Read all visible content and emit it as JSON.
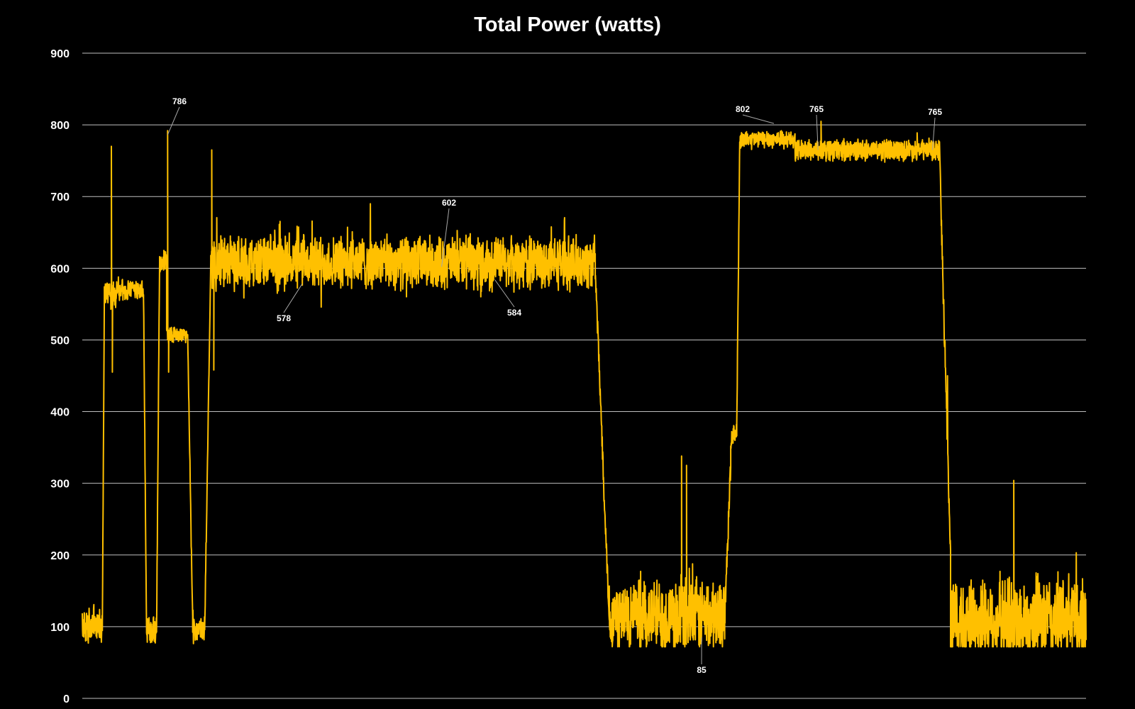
{
  "chart_data": {
    "type": "line",
    "title": "Total Power (watts)",
    "xlabel": "",
    "ylabel": "",
    "ylim": [
      0,
      900
    ],
    "yticks": [
      0,
      100,
      200,
      300,
      400,
      500,
      600,
      700,
      800,
      900
    ],
    "ytick_labels": [
      "0",
      "100",
      "200",
      "300",
      "400",
      "500",
      "600",
      "700",
      "800",
      "900"
    ],
    "grid": true,
    "legend": "none",
    "colors": {
      "line": "#FFC000",
      "background": "#000000",
      "grid": "#BFBFBF",
      "text": "#FFFFFF"
    },
    "series": [
      {
        "x_range": [
          0,
          1000
        ],
        "segments": [
          {
            "x": [
              0,
              20
            ],
            "base": 100,
            "noise": 28
          },
          {
            "x": [
              20,
              22
            ],
            "base_from": 100,
            "base_to": 565,
            "noise": 12
          },
          {
            "x": [
              22,
              61
            ],
            "base": 568,
            "noise": 18
          },
          {
            "x": [
              61,
              64
            ],
            "base_from": 565,
            "base_to": 95,
            "noise": 12
          },
          {
            "x": [
              64,
              74
            ],
            "base": 95,
            "noise": 20
          },
          {
            "x": [
              74,
              77
            ],
            "base_from": 95,
            "base_to": 610,
            "noise": 12
          },
          {
            "x": [
              77,
              84
            ],
            "base": 610,
            "noise": 18
          },
          {
            "x": [
              84,
              86
            ],
            "base": 505,
            "noise": 14
          },
          {
            "x": [
              86,
              105
            ],
            "base": 508,
            "noise": 12
          },
          {
            "x": [
              105,
              110
            ],
            "base_from": 505,
            "base_to": 100,
            "noise": 12
          },
          {
            "x": [
              110,
              122
            ],
            "base": 95,
            "noise": 20
          },
          {
            "x": [
              122,
              128
            ],
            "base_from": 95,
            "base_to": 610,
            "noise": 12
          },
          {
            "x": [
              128,
              511
            ],
            "base": 608,
            "noise": 42
          },
          {
            "x": [
              511,
              525
            ],
            "base_from": 600,
            "base_to": 110,
            "noise": 20
          },
          {
            "x": [
              525,
              640
            ],
            "base": 115,
            "noise": 60
          },
          {
            "x": [
              640,
              647
            ],
            "base_from": 110,
            "base_to": 365,
            "noise": 25
          },
          {
            "x": [
              647,
              652
            ],
            "base": 370,
            "noise": 18
          },
          {
            "x": [
              652,
              655
            ],
            "base_from": 380,
            "base_to": 780,
            "noise": 12
          },
          {
            "x": [
              655,
              710
            ],
            "base": 780,
            "noise": 14
          },
          {
            "x": [
              710,
              854
            ],
            "base": 765,
            "noise": 17
          },
          {
            "x": [
              854,
              865
            ],
            "base_from": 760,
            "base_to": 200,
            "noise": 25
          },
          {
            "x": [
              865,
              1000
            ],
            "base": 110,
            "noise": 70
          }
        ],
        "spikes": [
          {
            "x": 29,
            "y": 770
          },
          {
            "x": 30,
            "y": 455
          },
          {
            "x": 85,
            "y": 792
          },
          {
            "x": 86,
            "y": 455
          },
          {
            "x": 129,
            "y": 765
          },
          {
            "x": 131,
            "y": 458
          },
          {
            "x": 597,
            "y": 338
          },
          {
            "x": 602,
            "y": 325
          },
          {
            "x": 646,
            "y": 352
          },
          {
            "x": 736,
            "y": 805
          },
          {
            "x": 928,
            "y": 304
          },
          {
            "x": 862,
            "y": 450
          }
        ]
      }
    ],
    "annotations": [
      {
        "label": "786",
        "x": 85,
        "y": 786
      },
      {
        "label": "578",
        "x": 219,
        "y": 578
      },
      {
        "label": "602",
        "x": 358,
        "y": 602
      },
      {
        "label": "584",
        "x": 411,
        "y": 584
      },
      {
        "label": "85",
        "x": 617,
        "y": 85
      },
      {
        "label": "802",
        "x": 689,
        "y": 802
      },
      {
        "label": "765",
        "x": 733,
        "y": 765
      },
      {
        "label": "765",
        "x": 847,
        "y": 765
      }
    ]
  }
}
